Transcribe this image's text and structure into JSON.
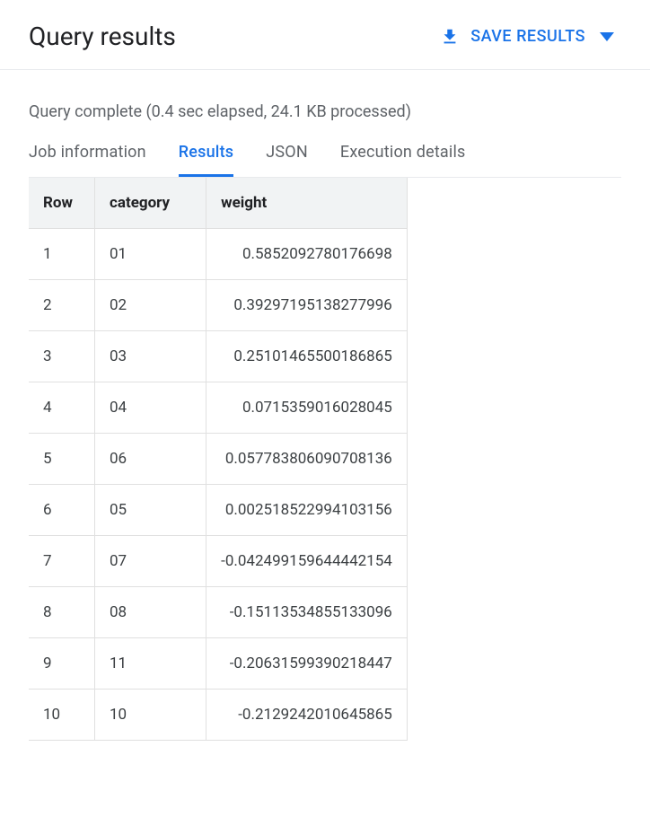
{
  "header": {
    "title": "Query results",
    "save_label": "SAVE RESULTS"
  },
  "status": "Query complete (0.4 sec elapsed, 24.1 KB processed)",
  "tabs": {
    "job_info": "Job information",
    "results": "Results",
    "json": "JSON",
    "execution": "Execution details"
  },
  "table": {
    "columns": {
      "row": "Row",
      "category": "category",
      "weight": "weight"
    },
    "rows": [
      {
        "row": "1",
        "category": "01",
        "weight": "0.5852092780176698"
      },
      {
        "row": "2",
        "category": "02",
        "weight": "0.39297195138277996"
      },
      {
        "row": "3",
        "category": "03",
        "weight": "0.25101465500186865"
      },
      {
        "row": "4",
        "category": "04",
        "weight": "0.0715359016028045"
      },
      {
        "row": "5",
        "category": "06",
        "weight": "0.057783806090708136"
      },
      {
        "row": "6",
        "category": "05",
        "weight": "0.002518522994103156"
      },
      {
        "row": "7",
        "category": "07",
        "weight": "-0.042499159644442154"
      },
      {
        "row": "8",
        "category": "08",
        "weight": "-0.15113534855133096"
      },
      {
        "row": "9",
        "category": "11",
        "weight": "-0.20631599390218447"
      },
      {
        "row": "10",
        "category": "10",
        "weight": "-0.2129242010645865"
      }
    ]
  }
}
